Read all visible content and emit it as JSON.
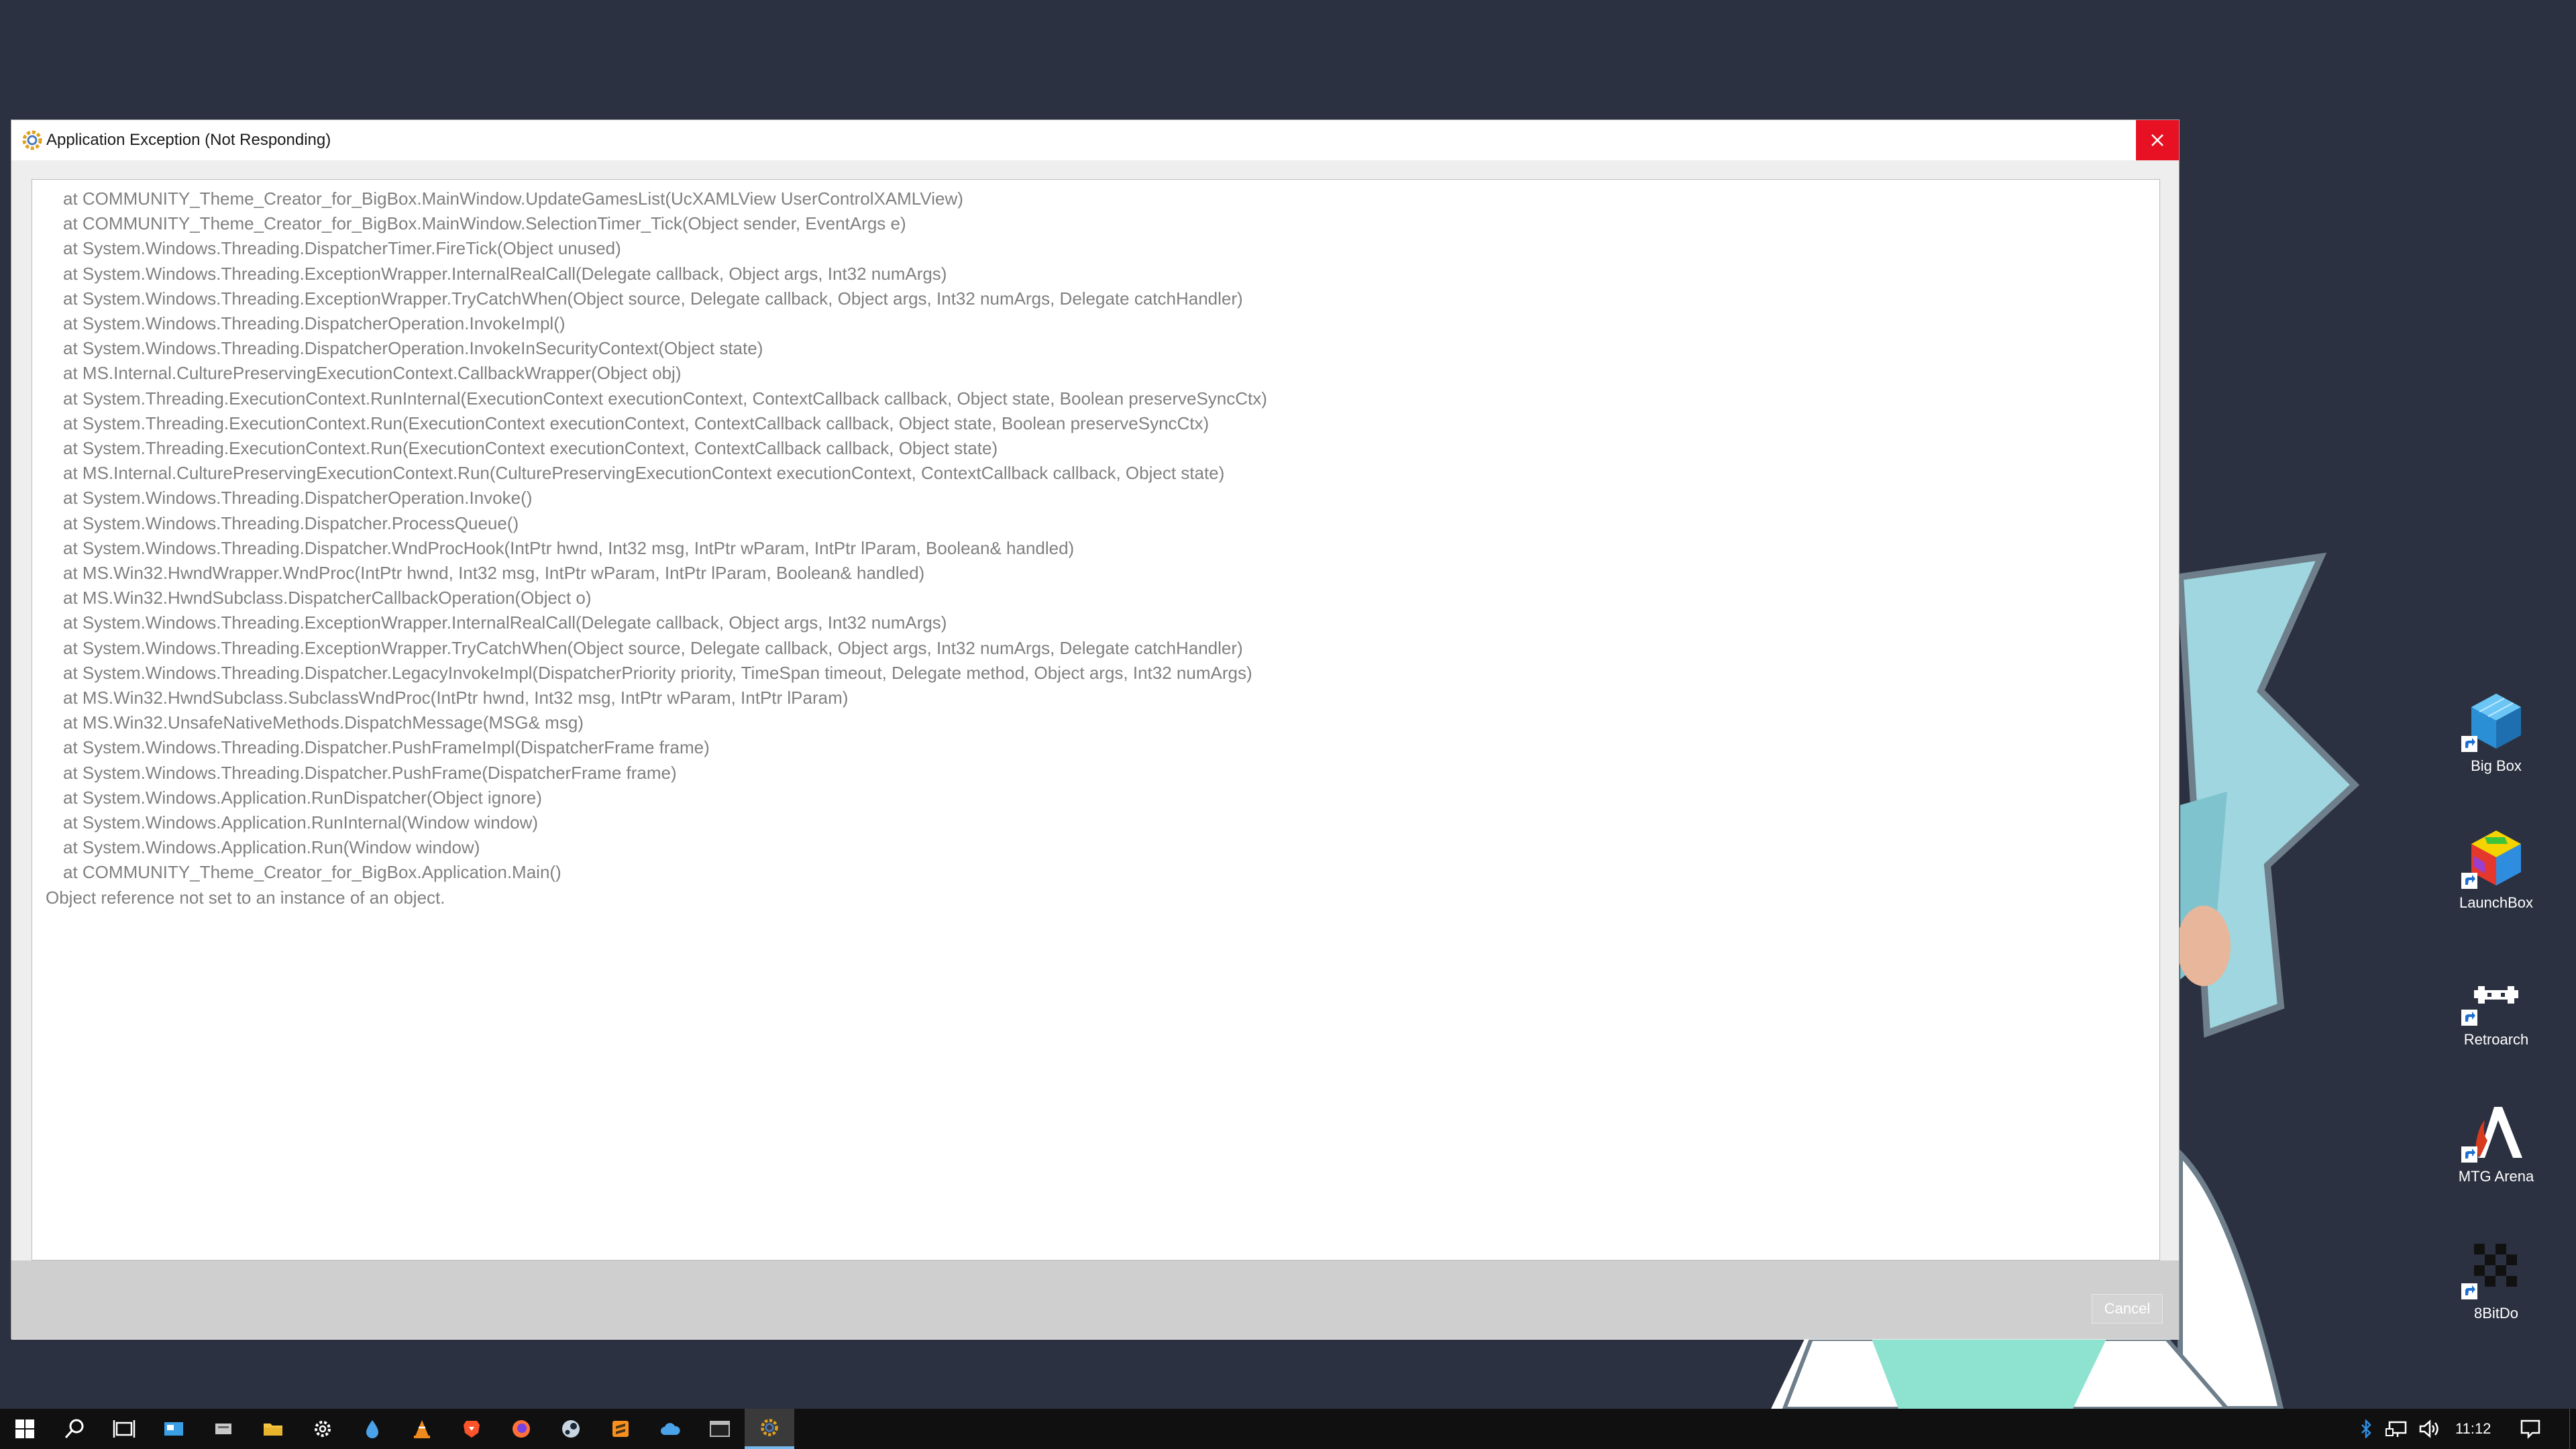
{
  "window": {
    "title": "Application Exception (Not Responding)",
    "close_icon": "close-icon"
  },
  "log": {
    "lines": [
      "at COMMUNITY_Theme_Creator_for_BigBox.MainWindow.UpdateGamesList(UcXAMLView UserControlXAMLView)",
      "at COMMUNITY_Theme_Creator_for_BigBox.MainWindow.SelectionTimer_Tick(Object sender, EventArgs e)",
      "at System.Windows.Threading.DispatcherTimer.FireTick(Object unused)",
      "at System.Windows.Threading.ExceptionWrapper.InternalRealCall(Delegate callback, Object args, Int32 numArgs)",
      "at System.Windows.Threading.ExceptionWrapper.TryCatchWhen(Object source, Delegate callback, Object args, Int32 numArgs, Delegate catchHandler)",
      "at System.Windows.Threading.DispatcherOperation.InvokeImpl()",
      "at System.Windows.Threading.DispatcherOperation.InvokeInSecurityContext(Object state)",
      "at MS.Internal.CulturePreservingExecutionContext.CallbackWrapper(Object obj)",
      "at System.Threading.ExecutionContext.RunInternal(ExecutionContext executionContext, ContextCallback callback, Object state, Boolean preserveSyncCtx)",
      "at System.Threading.ExecutionContext.Run(ExecutionContext executionContext, ContextCallback callback, Object state, Boolean preserveSyncCtx)",
      "at System.Threading.ExecutionContext.Run(ExecutionContext executionContext, ContextCallback callback, Object state)",
      "at MS.Internal.CulturePreservingExecutionContext.Run(CulturePreservingExecutionContext executionContext, ContextCallback callback, Object state)",
      "at System.Windows.Threading.DispatcherOperation.Invoke()",
      "at System.Windows.Threading.Dispatcher.ProcessQueue()",
      "at System.Windows.Threading.Dispatcher.WndProcHook(IntPtr hwnd, Int32 msg, IntPtr wParam, IntPtr lParam, Boolean& handled)",
      "at MS.Win32.HwndWrapper.WndProc(IntPtr hwnd, Int32 msg, IntPtr wParam, IntPtr lParam, Boolean& handled)",
      "at MS.Win32.HwndSubclass.DispatcherCallbackOperation(Object o)",
      "at System.Windows.Threading.ExceptionWrapper.InternalRealCall(Delegate callback, Object args, Int32 numArgs)",
      "at System.Windows.Threading.ExceptionWrapper.TryCatchWhen(Object source, Delegate callback, Object args, Int32 numArgs, Delegate catchHandler)",
      "at System.Windows.Threading.Dispatcher.LegacyInvokeImpl(DispatcherPriority priority, TimeSpan timeout, Delegate method, Object args, Int32 numArgs)",
      "at MS.Win32.HwndSubclass.SubclassWndProc(IntPtr hwnd, Int32 msg, IntPtr wParam, IntPtr lParam)",
      "at MS.Win32.UnsafeNativeMethods.DispatchMessage(MSG& msg)",
      "at System.Windows.Threading.Dispatcher.PushFrameImpl(DispatcherFrame frame)",
      "at System.Windows.Threading.Dispatcher.PushFrame(DispatcherFrame frame)",
      "at System.Windows.Application.RunDispatcher(Object ignore)",
      "at System.Windows.Application.RunInternal(Window window)",
      "at System.Windows.Application.Run(Window window)",
      "at COMMUNITY_Theme_Creator_for_BigBox.Application.Main()"
    ],
    "message": "Object reference not set to an instance of an object."
  },
  "buttons": {
    "cancel": "Cancel"
  },
  "desktop_icons": [
    {
      "label": "Big Box",
      "icon": "bigbox-cube-icon"
    },
    {
      "label": "LaunchBox",
      "icon": "launchbox-cube-icon"
    },
    {
      "label": "Retroarch",
      "icon": "retroarch-invader-icon"
    },
    {
      "label": "MTG Arena",
      "icon": "mtg-arena-icon"
    },
    {
      "label": "8BitDo",
      "icon": "8bitdo-icon"
    }
  ],
  "taskbar": {
    "clock": "11:12",
    "accent": "#76b9ed"
  }
}
